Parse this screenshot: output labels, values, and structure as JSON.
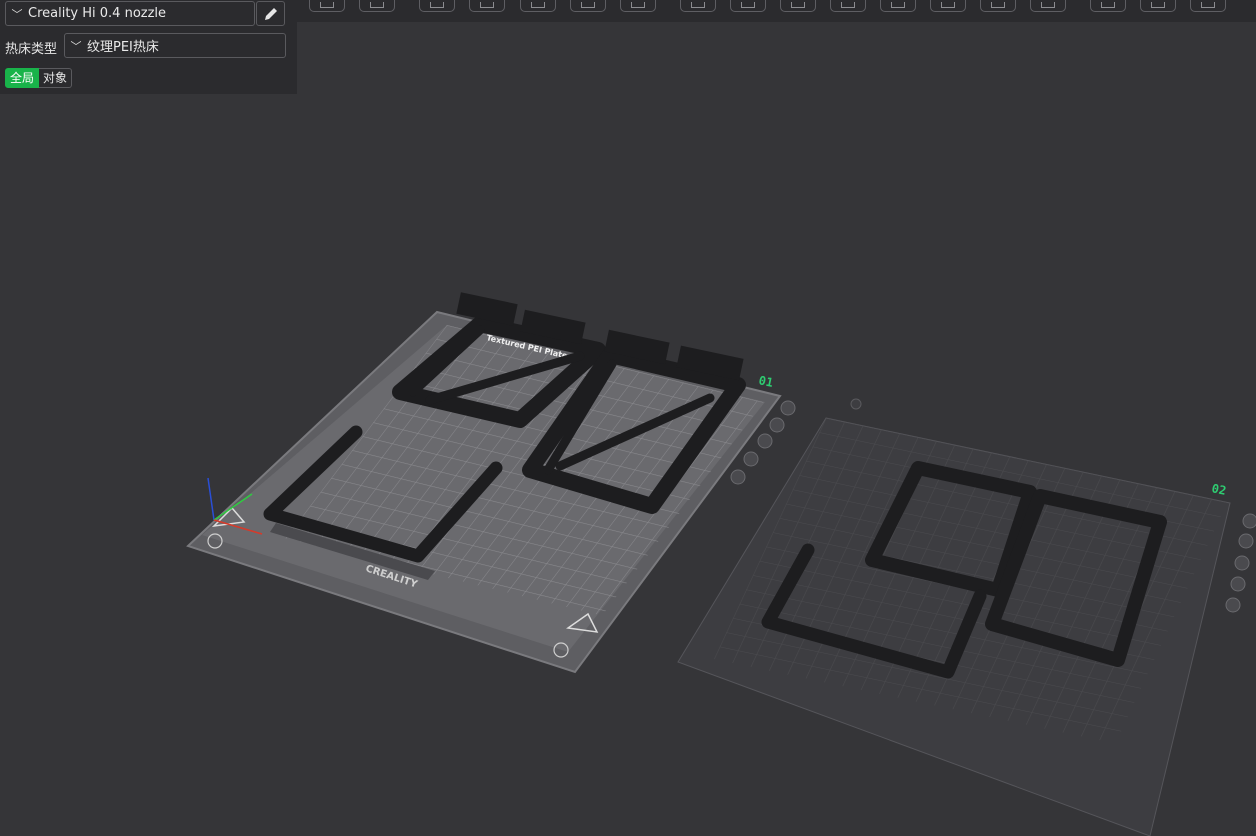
{
  "printer": {
    "name": "Creality Hi 0.4 nozzle"
  },
  "bed": {
    "label": "热床类型",
    "value": "纹理PEI热床"
  },
  "scope": {
    "global": "全局",
    "object": "对象"
  },
  "plates": [
    {
      "number": "01",
      "brand": "CREALITY",
      "plate_text": "Textured PEI Plate"
    },
    {
      "number": "02"
    }
  ],
  "toolbar": {
    "icons": [
      "view-3d-icon",
      "keyboard-icon",
      "orient-icon",
      "arrange-icon",
      "slice-icon",
      "layout-icon",
      "split-icon",
      "grid-icon",
      "support-icon",
      "measure-icon",
      "cut-icon",
      "paint-icon",
      "seam-icon",
      "text-icon",
      "emboss-icon",
      "assemble-icon",
      "scale-icon",
      "mesh-icon"
    ]
  },
  "colors": {
    "accent": "#19b34a",
    "plate_number": "#2ecc71",
    "background": "#353538"
  }
}
